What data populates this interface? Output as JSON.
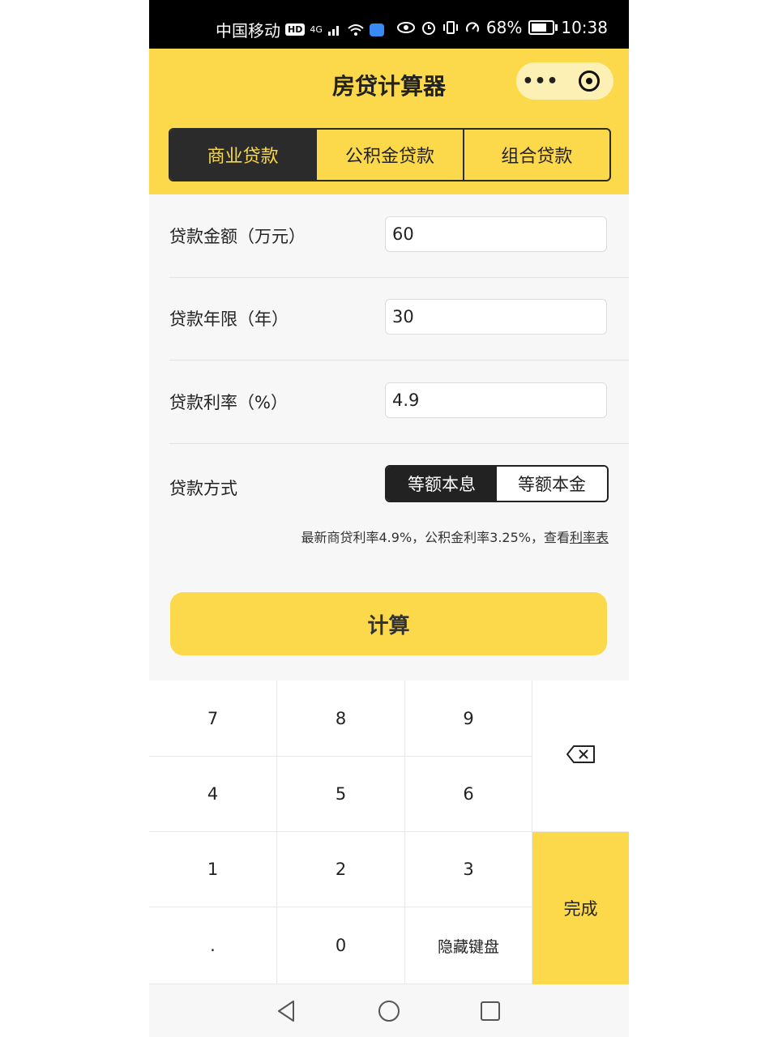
{
  "status_bar": {
    "carrier": "中国移动",
    "hd": "HD",
    "network": "4G",
    "battery": "68%",
    "time": "10:38"
  },
  "header": {
    "title": "房贷计算器",
    "more_label": "•••",
    "tabs": [
      "商业贷款",
      "公积金贷款",
      "组合贷款"
    ],
    "active_tab": "商业贷款"
  },
  "form": {
    "amount_label": "贷款金额（万元）",
    "amount_value": "60",
    "term_label": "贷款年限（年）",
    "term_value": "30",
    "rate_label": "贷款利率（%）",
    "rate_value": "4.9",
    "method_label": "贷款方式",
    "method_options": [
      "等额本息",
      "等额本金"
    ],
    "method_selected": "等额本息",
    "note_text": "最新商贷利率4.9%，公积金利率3.25%，查看",
    "note_link": "利率表",
    "calc_button": "计算"
  },
  "keypad": {
    "keys": [
      "7",
      "8",
      "9",
      "4",
      "5",
      "6",
      "1",
      "2",
      "3",
      ".",
      "0",
      "隐藏键盘"
    ],
    "done": "完成"
  },
  "colors": {
    "accent": "#fcd94a",
    "dark": "#2b2b2b"
  }
}
